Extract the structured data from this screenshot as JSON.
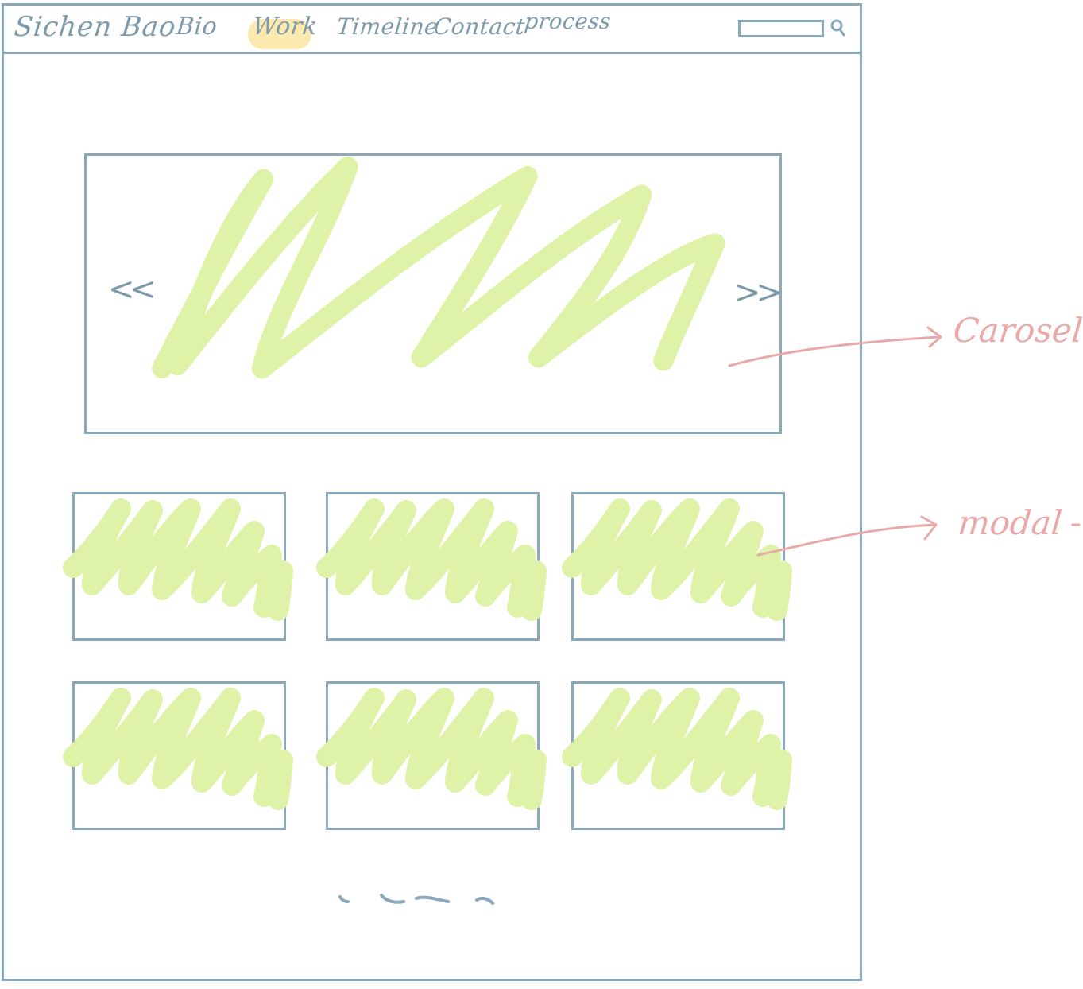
{
  "nav": {
    "brand": "Sichen Bao",
    "items": [
      {
        "label": "Bio"
      },
      {
        "label": "Work",
        "active": true
      },
      {
        "label": "Timeline"
      },
      {
        "label": "Contact"
      },
      {
        "label": "process"
      }
    ],
    "search": {
      "value": "",
      "placeholder": ""
    }
  },
  "carousel": {
    "prev_label": "<<",
    "next_label": ">>"
  },
  "annotations": {
    "carousel_label": "Carosel",
    "modal_label": "modal"
  },
  "colors": {
    "wireframe": "#89a9bc",
    "scribble": "#dff3a8",
    "highlight": "#fbe7a6",
    "annotation": "#eaa9a9"
  },
  "icons": {
    "search": "search-icon"
  }
}
